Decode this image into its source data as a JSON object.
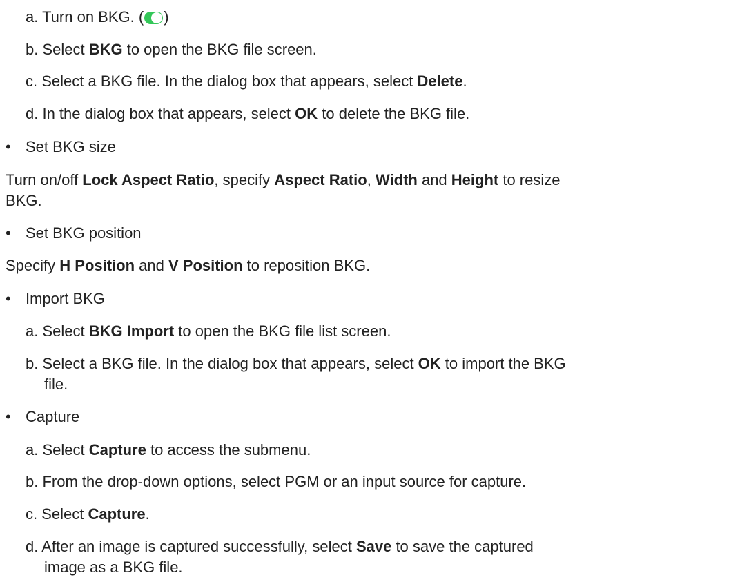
{
  "toggle_color": "#34c759",
  "delete_steps": {
    "a_prefix": "a. Turn on BKG. (",
    "a_suffix": ")",
    "b_pre": "b. Select ",
    "b_bold": "BKG",
    "b_post": " to open the BKG file screen.",
    "c_pre": "c. Select a BKG file. In the dialog box that appears, select ",
    "c_bold": "Delete",
    "c_post": ".",
    "d_pre": "d. In the dialog box that appears, select ",
    "d_bold": "OK",
    "d_post": " to delete the BKG file."
  },
  "bullets": {
    "marker": "•",
    "size_title": "Set BKG size",
    "position_title": "Set BKG position",
    "import_title": "Import BKG",
    "capture_title": "Capture"
  },
  "size_desc": {
    "p1": "Turn on/off ",
    "b1": "Lock Aspect Ratio",
    "p2": ", specify ",
    "b2": "Aspect Ratio",
    "p3": ", ",
    "b3": "Width",
    "p4": " and ",
    "b4": "Height",
    "p5": " to resize",
    "line2": "BKG."
  },
  "position_desc": {
    "p1": "Specify ",
    "b1": "H Position",
    "p2": " and ",
    "b2": "V Position",
    "p3": " to reposition BKG."
  },
  "import_steps": {
    "a_pre": "a. Select ",
    "a_bold": "BKG Import",
    "a_post": " to open the BKG file list screen.",
    "b_pre": "b. Select a BKG file. In the dialog box that appears, select ",
    "b_bold": "OK",
    "b_post": " to import the BKG",
    "b_line2": "file."
  },
  "capture_steps": {
    "a_pre": "a. Select ",
    "a_bold": "Capture",
    "a_post": " to access the submenu.",
    "b": "b. From the drop-down options, select PGM or an input source for capture.",
    "c_pre": "c. Select ",
    "c_bold": "Capture",
    "c_post": ".",
    "d_pre": "d. After an image is captured successfully, select ",
    "d_bold": "Save",
    "d_post": " to save the captured",
    "d_line2": "image as a BKG file."
  }
}
